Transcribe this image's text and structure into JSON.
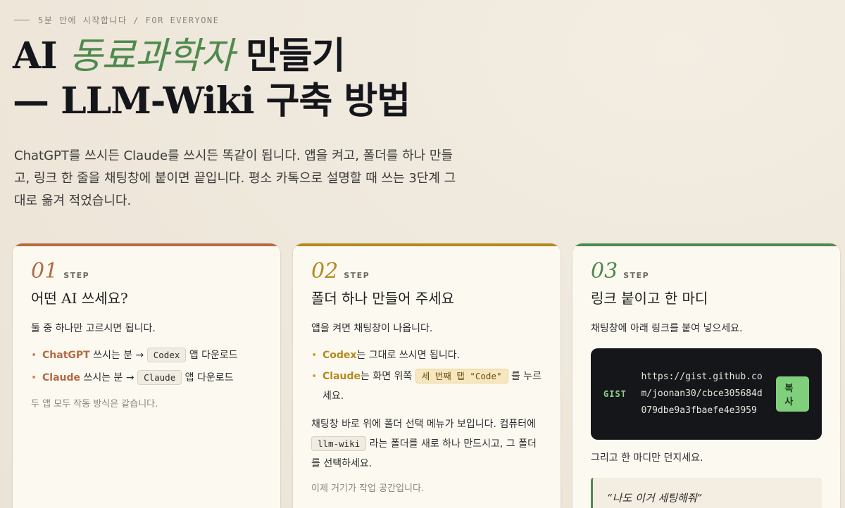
{
  "eyebrow": "5분 만에 시작합니다 / FOR EVERYONE",
  "headline": {
    "pre": "AI ",
    "accent": "동료과학자",
    "post_line1": " 만들기",
    "line2": "— LLM-Wiki 구축 방법"
  },
  "intro": "ChatGPT를 쓰시든 Claude를 쓰시든 똑같이 됩니다. 앱을 켜고, 폴더를 하나 만들고, 링크 한 줄을 채팅창에 붙이면 끝입니다. 평소 카톡으로 설명할 때 쓰는 3단계 그대로 옮겨 적었습니다.",
  "cards": [
    {
      "num": "01",
      "label": "STEP",
      "title": "어떤 AI 쓰세요?",
      "lead": "둘 중 하나만 고르시면 됩니다.",
      "items": [
        {
          "name": "ChatGPT",
          "mid": " 쓰시는 분 → ",
          "code": "Codex",
          "tail": " 앱 다운로드"
        },
        {
          "name": "Claude",
          "mid": " 쓰시는 분 → ",
          "code": "Claude",
          "tail": " 앱 다운로드"
        }
      ],
      "note": "두 앱 모두 작동 방식은 같습니다."
    },
    {
      "num": "02",
      "label": "STEP",
      "title": "폴더 하나 만들어 주세요",
      "lead": "앱을 켜면 채팅창이 나옵니다.",
      "items": [
        {
          "name": "Codex",
          "mid": "는 그대로 쓰시면 됩니다.",
          "code": "",
          "tail": ""
        },
        {
          "name": "Claude",
          "mid": "는 화면 위쪽 ",
          "code": "세 번째 탭 \"Code\"",
          "tail": " 를 누르세요."
        }
      ],
      "para_a": "채팅창 바로 위에 폴더 선택 메뉴가 보입니다. 컴퓨터에 ",
      "para_code": "llm-wiki",
      "para_b": " 라는 폴더를 새로 하나 만드시고, 그 폴더를 선택하세요.",
      "note": "이제 거기가 작업 공간입니다."
    },
    {
      "num": "03",
      "label": "STEP",
      "title": "링크 붙이고 한 마디",
      "lead": "채팅창에 아래 링크를 붙여 넣으세요.",
      "gist_tag": "GIST",
      "gist_url": "https://gist.github.com/joonan30/cbce305684d079dbe9a3fbaefe4e3959",
      "copy_label": "복사",
      "after": "그리고 한 마디만 던지세요.",
      "quote": "“나도 이거 세팅해줘”"
    }
  ],
  "colors": {
    "step1": "#b56a42",
    "step2": "#b38a1d",
    "step3": "#4f8a4e"
  }
}
